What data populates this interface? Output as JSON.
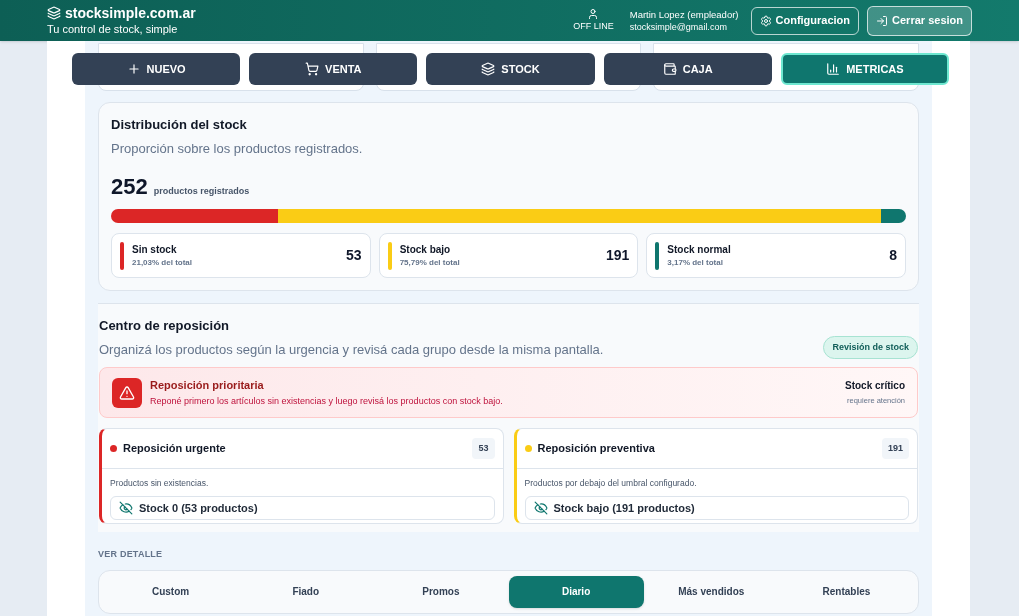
{
  "header": {
    "brand": "stocksimple.com.ar",
    "tagline": "Tu control de stock, simple",
    "status": "OFF LINE",
    "user_name": "Martin Lopez (empleador)",
    "user_email": "stocksimple@gmail.com",
    "buttons": [
      {
        "kind": "settings",
        "label": "Configuracion"
      },
      {
        "kind": "logout",
        "label": "Cerrar sesion"
      }
    ]
  },
  "nav": [
    {
      "kind": "plus",
      "label": "NUEVO",
      "selected": false
    },
    {
      "kind": "cart",
      "label": "VENTA",
      "selected": false
    },
    {
      "kind": "layers",
      "label": "STOCK",
      "selected": false
    },
    {
      "kind": "cash",
      "label": "CAJA",
      "selected": false
    },
    {
      "kind": "chart",
      "label": "METRICAS",
      "selected": true
    }
  ],
  "distribution": {
    "title": "Distribución del stock",
    "subtitle": "Proporción sobre los productos registrados.",
    "total": "252",
    "total_label": "productos registrados",
    "segments": [
      {
        "label": "Sin stock",
        "share": "21,03% del total",
        "count": "53",
        "color": "#dc2626"
      },
      {
        "label": "Stock bajo",
        "share": "75,79% del total",
        "count": "191",
        "color": "#facc15"
      },
      {
        "label": "Stock normal",
        "share": "3,17% del total",
        "count": "8",
        "color": "#0f766e"
      }
    ]
  },
  "replenishment": {
    "title": "Centro de reposición",
    "subtitle": "Organizá los productos según la urgencia y revisá cada grupo desde la misma pantalla.",
    "badge": "Revisión de stock",
    "alert": {
      "title": "Reposición prioritaria",
      "text": "Reponé primero los artículos sin existencias y luego revisá los productos con stock bajo.",
      "status": "Stock crítico",
      "status_note": "requiere atención"
    },
    "groups": [
      {
        "title": "Reposición urgente",
        "count": "53",
        "color": "#dc2626",
        "description": "Productos sin existencias.",
        "filter": "Stock 0 (53 productos)"
      },
      {
        "title": "Reposición preventiva",
        "count": "191",
        "color": "#facc15",
        "description": "Productos por debajo del umbral configurado.",
        "filter": "Stock bajo (191 productos)"
      }
    ]
  },
  "detail": {
    "heading": "VER DETALLE",
    "tabs": [
      {
        "label": "Custom",
        "selected": false
      },
      {
        "label": "Fiado",
        "selected": false
      },
      {
        "label": "Promos",
        "selected": false
      },
      {
        "label": "Diario",
        "selected": true
      },
      {
        "label": "Más vendidos",
        "selected": false
      },
      {
        "label": "Rentables",
        "selected": false
      }
    ]
  }
}
